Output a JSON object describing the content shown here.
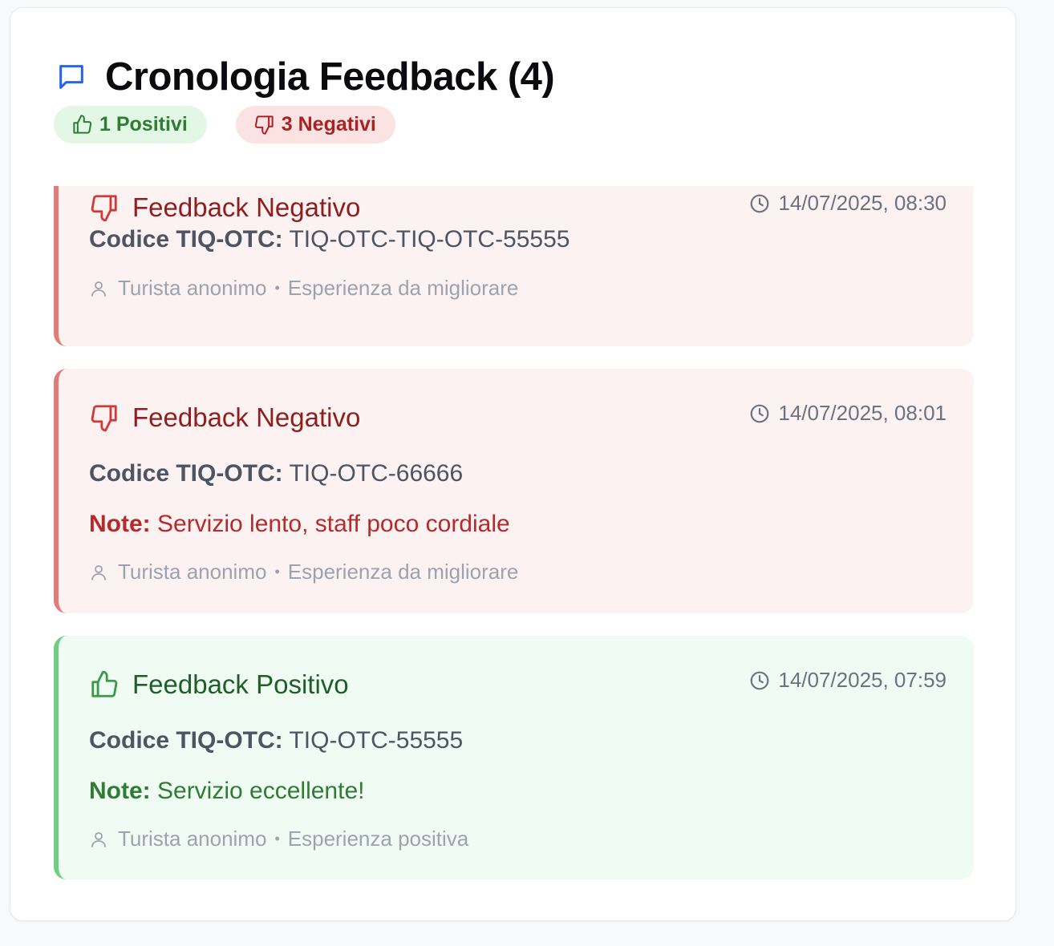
{
  "header": {
    "title": "Cronologia Feedback (4)",
    "icon": "chat-bubble-icon",
    "accent": "#2563eb"
  },
  "badges": {
    "positive_label": "1 Positivi",
    "negative_label": "3 Negativi"
  },
  "items": [
    {
      "type": "negative",
      "title": "Feedback Negativo",
      "time": "14/07/2025, 08:30",
      "code_label": "Codice TIQ-OTC:",
      "code_value": "TIQ-OTC-TIQ-OTC-55555",
      "user": "Turista anonimo",
      "separator": "•",
      "experience": "Esperienza da migliorare"
    },
    {
      "type": "negative",
      "title": "Feedback Negativo",
      "time": "14/07/2025, 08:01",
      "code_label": "Codice TIQ-OTC:",
      "code_value": "TIQ-OTC-66666",
      "note_label": "Note:",
      "note_value": "Servizio lento, staff poco cordiale",
      "user": "Turista anonimo",
      "separator": "•",
      "experience": "Esperienza da migliorare"
    },
    {
      "type": "positive",
      "title": "Feedback Positivo",
      "time": "14/07/2025, 07:59",
      "code_label": "Codice TIQ-OTC:",
      "code_value": "TIQ-OTC-55555",
      "note_label": "Note:",
      "note_value": "Servizio eccellente!",
      "user": "Turista anonimo",
      "separator": "•",
      "experience": "Esperienza positiva"
    }
  ],
  "colors": {
    "positive": "#2e7d32",
    "negative": "#a82424",
    "positive_bg": "#f0fbf3",
    "negative_bg": "#fdf2f2"
  }
}
